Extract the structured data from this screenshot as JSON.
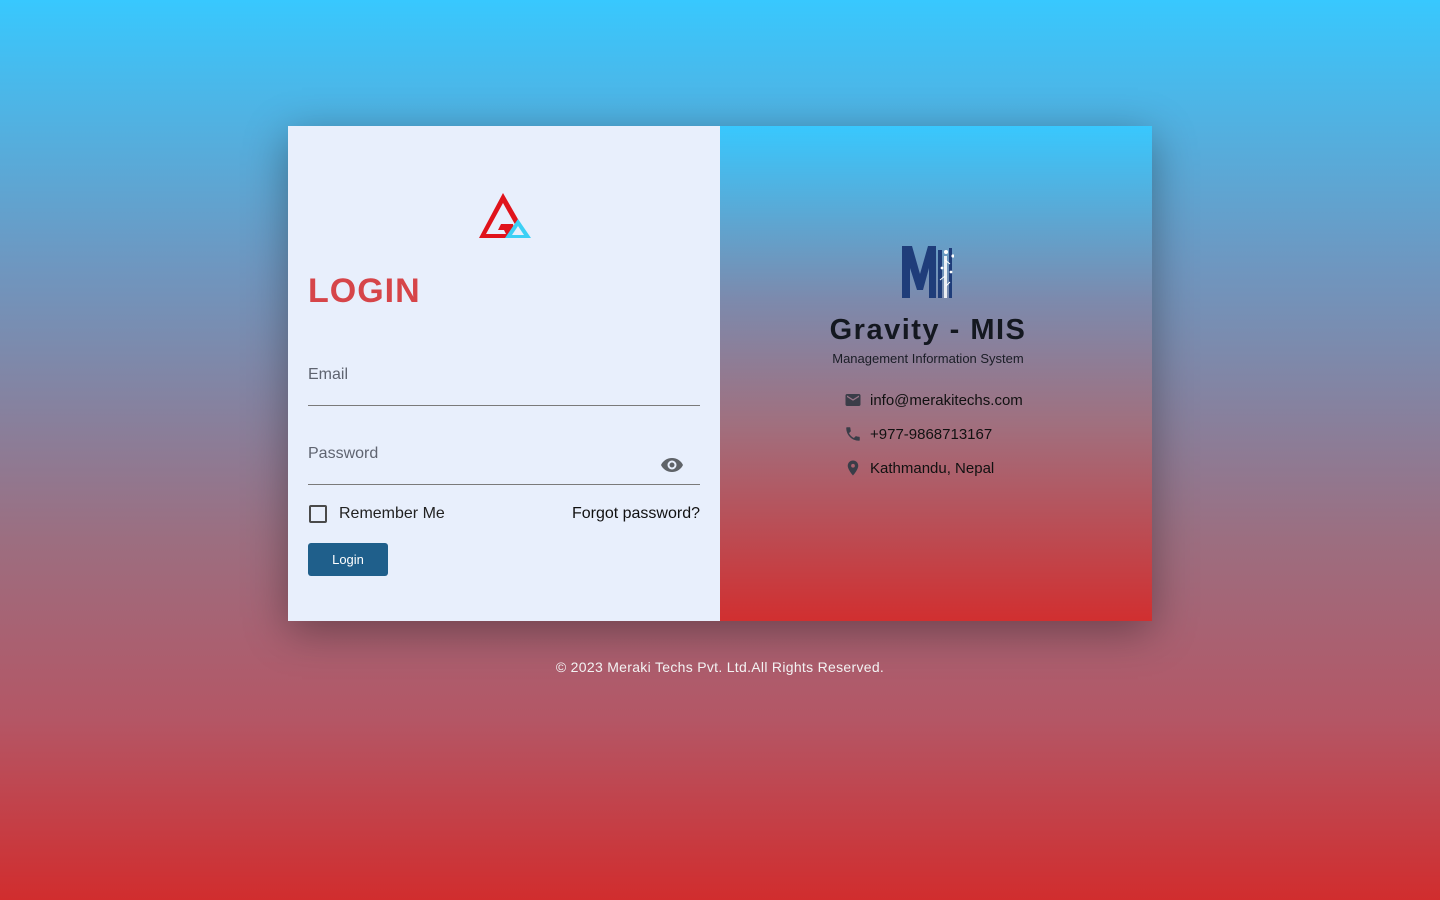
{
  "login": {
    "title": "LOGIN",
    "email_placeholder": "Email",
    "password_placeholder": "Password",
    "remember_label": "Remember Me",
    "forgot_label": "Forgot password?",
    "button_label": "Login"
  },
  "brand": {
    "title": "Gravity - MIS",
    "subtitle": "Management Information System",
    "logo_icon": "meraki-techs-logo",
    "ga_logo_icon": "gravity-logo"
  },
  "contact": {
    "email": "info@merakitechs.com",
    "phone": "+977-9868713167",
    "location": "Kathmandu, Nepal"
  },
  "footer": {
    "text": "© 2023 Meraki Techs Pvt. Ltd.All Rights Reserved."
  },
  "colors": {
    "accent_red": "#d64549",
    "button_blue": "#1f5f8b",
    "gradient_top": "#38c8fe",
    "gradient_bottom": "#d12d2e"
  }
}
